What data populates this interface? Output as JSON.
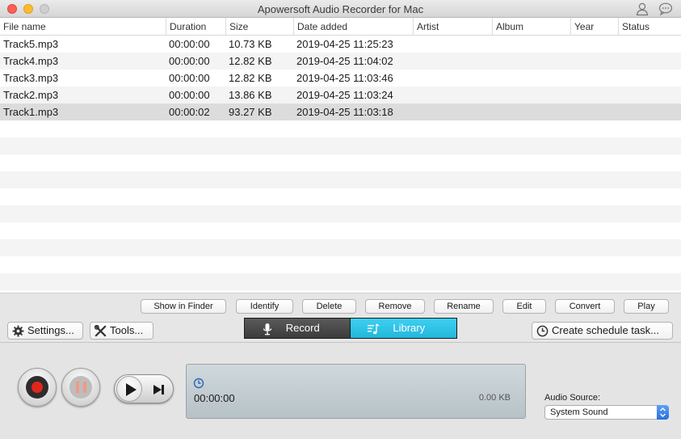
{
  "window": {
    "title": "Apowersoft Audio Recorder for Mac"
  },
  "table": {
    "columns": [
      "File name",
      "Duration",
      "Size",
      "Date added",
      "Artist",
      "Album",
      "Year",
      "Status"
    ],
    "rows": [
      {
        "name": "Track5.mp3",
        "duration": "00:00:00",
        "size": "10.73 KB",
        "date": "2019-04-25 11:25:23",
        "artist": "",
        "album": "",
        "year": "",
        "status": ""
      },
      {
        "name": "Track4.mp3",
        "duration": "00:00:00",
        "size": "12.82 KB",
        "date": "2019-04-25 11:04:02",
        "artist": "",
        "album": "",
        "year": "",
        "status": ""
      },
      {
        "name": "Track3.mp3",
        "duration": "00:00:00",
        "size": "12.82 KB",
        "date": "2019-04-25 11:03:46",
        "artist": "",
        "album": "",
        "year": "",
        "status": ""
      },
      {
        "name": "Track2.mp3",
        "duration": "00:00:00",
        "size": "13.86 KB",
        "date": "2019-04-25 11:03:24",
        "artist": "",
        "album": "",
        "year": "",
        "status": ""
      },
      {
        "name": "Track1.mp3",
        "duration": "00:00:02",
        "size": "93.27 KB",
        "date": "2019-04-25 11:03:18",
        "artist": "",
        "album": "",
        "year": "",
        "status": ""
      }
    ],
    "selected_row": "Track1.mp3"
  },
  "actions": {
    "show_in_finder": "Show in Finder",
    "identify": "Identify",
    "delete": "Delete",
    "remove": "Remove",
    "rename": "Rename",
    "edit": "Edit",
    "convert": "Convert",
    "play": "Play"
  },
  "toolbar": {
    "settings": "Settings...",
    "tools": "Tools...",
    "record_tab": "Record",
    "library_tab": "Library",
    "active_tab": "Library",
    "schedule": "Create schedule task..."
  },
  "player": {
    "time": "00:00:00",
    "file_size": "0.00 KB"
  },
  "audio_source": {
    "label": "Audio Source:",
    "selected": "System Sound"
  },
  "colors": {
    "library_accent": "#22b7db",
    "record_button": "#e1261c",
    "select_accent": "#2b6fdc"
  },
  "icons": [
    "user-icon",
    "chat-icon",
    "gear-icon",
    "tools-icon",
    "microphone-icon",
    "music-note-icon",
    "clock-icon",
    "record-icon",
    "pause-icon",
    "play-icon",
    "skip-next-icon"
  ]
}
